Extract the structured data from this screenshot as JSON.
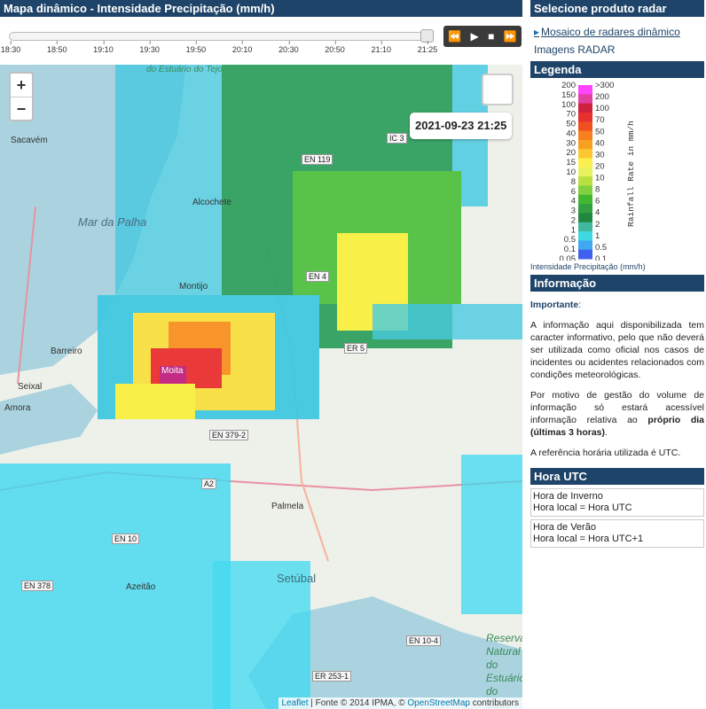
{
  "left": {
    "title": "Mapa dinâmico - Intensidade Precipitação (mm/h)",
    "timeline": {
      "ticks": [
        "18:30",
        "18:50",
        "19:10",
        "19:30",
        "19:50",
        "20:10",
        "20:30",
        "20:50",
        "21:10",
        "21:25"
      ],
      "position": 1.0
    },
    "controls": {
      "rewind": "⏪",
      "play": "▶",
      "stop": "■",
      "forward": "⏩"
    },
    "map": {
      "timestamp": "2021-09-23 21:25",
      "zoom_in": "+",
      "zoom_out": "−",
      "attribution_leaflet": "Leaflet",
      "attribution_text": " | Fonte © 2014 IPMA, © ",
      "attribution_osm": "OpenStreetMap",
      "attribution_tail": " contributors",
      "places": [
        "Sacavém",
        "Mar da Palha",
        "Alcochete",
        "Montijo",
        "Barreiro",
        "Moita",
        "Seixal",
        "Amora",
        "Palmela",
        "Setúbal",
        "Azeitão",
        "do Estuário do Tejo"
      ],
      "roads": [
        "EN 119",
        "EN 4",
        "ER 5",
        "EN 379-2",
        "EN 10",
        "EN 378",
        "EN 10-4",
        "ER 253-1",
        "IC 3",
        "A2"
      ],
      "reserve_label": [
        "Reserva",
        "Natural",
        "do Estuário",
        "do Sado"
      ]
    }
  },
  "right": {
    "product_title": "Selecione produto radar",
    "products": [
      "Mosaico de radares dinâmico",
      "Imagens RADAR"
    ],
    "legend_title": "Legenda",
    "legend": {
      "left_labels": [
        "200",
        "150",
        "100",
        "70",
        "50",
        "40",
        "30",
        "20",
        "15",
        "10",
        "8",
        "6",
        "4",
        "3",
        "2",
        "1",
        "0.5",
        "0.1",
        "0.05"
      ],
      "right_labels": [
        ">300",
        "200",
        "100",
        "70",
        "50",
        "40",
        "30",
        "20",
        "10",
        "8",
        "6",
        "4",
        "2",
        "1",
        "0.5",
        "0.1"
      ],
      "axis_label": "Rainfall Rate in mm/h",
      "caption": "Intensidade Precipitação (mm/h)",
      "colors": [
        "#ff44ff",
        "#e040a0",
        "#d02040",
        "#e83030",
        "#f05020",
        "#f88020",
        "#f8a020",
        "#fcc830",
        "#fcf050",
        "#e8f060",
        "#b8e040",
        "#80d040",
        "#40b830",
        "#30a040",
        "#208840",
        "#40b8a0",
        "#40d8e0",
        "#40a8f0",
        "#4060f0"
      ]
    },
    "info_title": "Informação",
    "info": {
      "important": "Importante",
      "p1": "A informação aqui disponibilizada tem caracter informativo, pelo que não deverá ser utilizada como oficial nos casos de incidentes ou acidentes relacionados com condições meteorológicas.",
      "p2_a": "Por motivo de gestão do volume de informação só estará acessível informação relativa ao ",
      "p2_b": "próprio dia (últimas 3 horas)",
      "p2_c": ".",
      "p3": "A referência horária utilizada é UTC."
    },
    "utc_title": "Hora UTC",
    "utc": [
      {
        "title": "Hora de Inverno",
        "text": "Hora local = Hora UTC"
      },
      {
        "title": "Hora de Verão",
        "text": "Hora local = Hora UTC+1"
      }
    ]
  }
}
